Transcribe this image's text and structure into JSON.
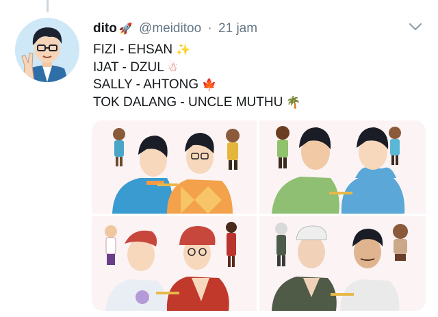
{
  "tweet": {
    "display_name": "dito",
    "name_emoji": "🚀",
    "handle": "@meiditoo",
    "separator": "·",
    "time": "21 jam",
    "lines": [
      {
        "text": "FIZI - EHSAN",
        "emoji": "✨"
      },
      {
        "text": "IJAT - DZUL",
        "emoji": "☃"
      },
      {
        "text": "SALLY - AHTONG",
        "emoji": "🍁"
      },
      {
        "text": "TOK DALANG - UNCLE MUTHU",
        "emoji": "🌴"
      }
    ]
  },
  "icons": {
    "more": "chevron-down-icon",
    "avatar": "user-avatar"
  },
  "colors": {
    "text": "#14171a",
    "muted": "#657786",
    "thread_line": "#ccd6dd",
    "tile_bg": "#fbf5f6"
  }
}
